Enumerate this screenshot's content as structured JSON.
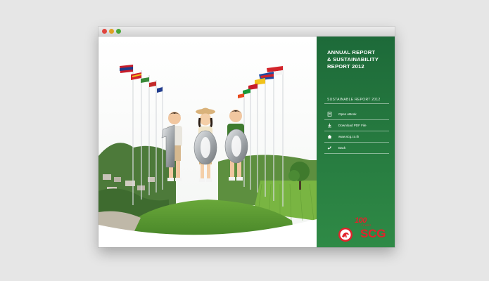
{
  "window": {
    "title_visible": false
  },
  "panel": {
    "title_lines": [
      "ANNUAL REPORT",
      "& SUSTAINABILITY",
      "REPORT 2012"
    ],
    "section_label": "SUSTAINABLE REPORT 2012",
    "menu": [
      {
        "label": "Open eBook",
        "icon": "book-icon"
      },
      {
        "label": "Download PDF File",
        "icon": "download-icon"
      },
      {
        "label": "www.scg.co.th",
        "icon": "home-icon"
      },
      {
        "label": "Back",
        "icon": "back-arrow-icon"
      }
    ]
  },
  "hero": {
    "number_text": "100"
  },
  "logo": {
    "anniversary": "100",
    "years": "YEARS",
    "brand": "SCG"
  },
  "colors": {
    "panel_green": "#2f8a46",
    "brand_red": "#e2222b",
    "background": "#e6e6e6"
  }
}
